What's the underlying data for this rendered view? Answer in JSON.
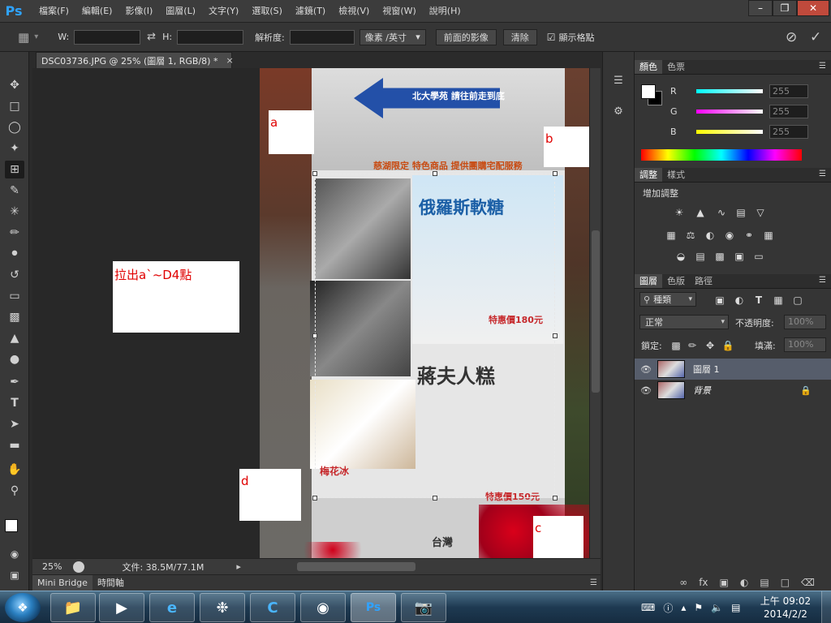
{
  "app": {
    "logo": "Ps",
    "menu": [
      "檔案(F)",
      "編輯(E)",
      "影像(I)",
      "圖層(L)",
      "文字(Y)",
      "選取(S)",
      "濾鏡(T)",
      "檢視(V)",
      "視窗(W)",
      "說明(H)"
    ]
  },
  "options": {
    "w_label": "W:",
    "h_label": "H:",
    "resolution_label": "解析度:",
    "unit": "像素 /英寸",
    "front_image": "前面的影像",
    "clear": "清除",
    "show_grid": "顯示格點"
  },
  "document": {
    "tab_title": "DSC03736.JPG @ 25% (圖層 1, RGB/8) *",
    "zoom": "25%",
    "file_info": "文件: 38.5M/77.1M",
    "photo_text": {
      "arrow": "北大學苑 請往前走到底",
      "orange_line": "慈湖限定 特色商品  提供團購宅配服務",
      "candy": "俄羅斯軟糖",
      "price1": "特惠價180元",
      "cake": "蔣夫人糕",
      "mei": "梅花冰",
      "price2": "特惠價150元",
      "taiwan": "台灣"
    }
  },
  "annotations": {
    "a": "a",
    "b": "b",
    "c": "c",
    "d": "d",
    "instruction": "拉出a`~D4點"
  },
  "bottom_tabs": [
    "Mini Bridge",
    "時間軸"
  ],
  "color_panel": {
    "tabs": [
      "顏色",
      "色票"
    ],
    "r_label": "R",
    "g_label": "G",
    "b_label": "B",
    "r": "255",
    "g": "255",
    "b": "255"
  },
  "adjustments_panel": {
    "tabs": [
      "調整",
      "樣式"
    ],
    "heading": "增加調整"
  },
  "layers_panel": {
    "tabs": [
      "圖層",
      "色版",
      "路徑"
    ],
    "filter": "種類",
    "blend_mode": "正常",
    "opacity_label": "不透明度:",
    "opacity": "100%",
    "lock_label": "鎖定:",
    "fill_label": "填滿:",
    "fill": "100%",
    "layers": [
      {
        "name": "圖層 1"
      },
      {
        "name": "背景"
      }
    ]
  },
  "taskbar": {
    "time": "上午 09:02",
    "date": "2014/2/2"
  },
  "colors": {
    "accent": "#2fa3ff",
    "selected_layer": "#565d6b",
    "annotation_red": "#e00000"
  }
}
